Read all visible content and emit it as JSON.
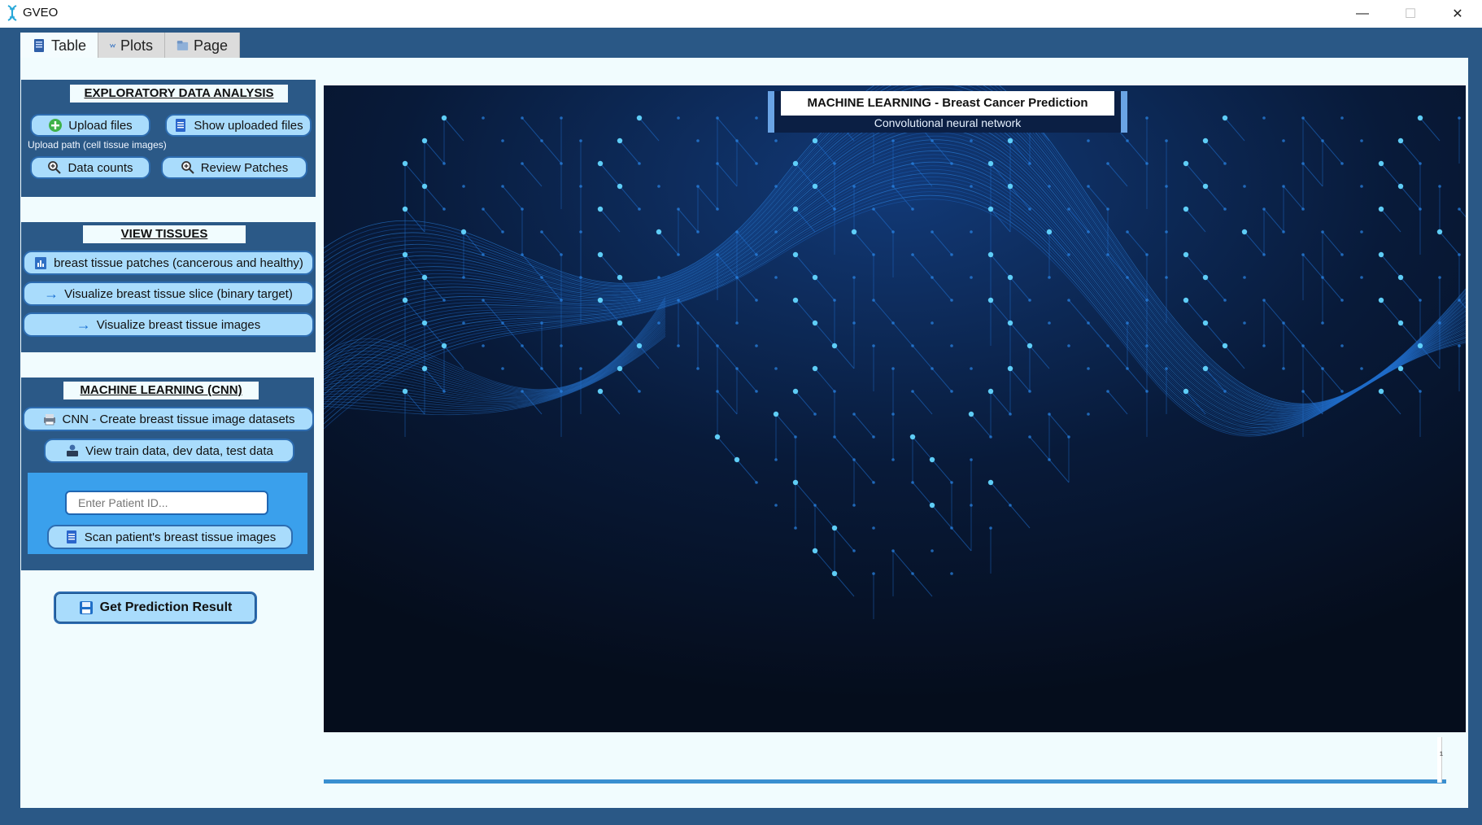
{
  "window": {
    "title": "GVEO",
    "minimize_glyph": "—",
    "maximize_glyph": "☐",
    "close_glyph": "✕"
  },
  "tabs": [
    {
      "label": "Table",
      "icon": "table-icon",
      "active": true
    },
    {
      "label": "Plots",
      "icon": "plots-icon",
      "active": false
    },
    {
      "label": "Page",
      "icon": "page-icon",
      "active": false
    }
  ],
  "eda": {
    "title": "EXPLORATORY DATA ANALYSIS",
    "upload_label": "Upload files",
    "show_uploaded_label": "Show uploaded files",
    "upload_path_label": "Upload path (cell tissue images)",
    "data_counts_label": "Data counts",
    "review_patches_label": "Review Patches"
  },
  "view_tissues": {
    "title": "VIEW TISSUES",
    "patches_label": "breast tissue patches (cancerous and healthy)",
    "slice_label": "Visualize  breast tissue slice (binary target)",
    "images_label": "Visualize  breast tissue images"
  },
  "ml": {
    "title": "MACHINE LEARNING (CNN)",
    "create_datasets_label": "CNN - Create breast tissue image datasets",
    "view_data_label": "View train data, dev data, test data",
    "patient_placeholder": "Enter Patient ID...",
    "scan_label": "Scan patient's breast tissue images"
  },
  "predict": {
    "label": "Get Prediction Result"
  },
  "hero": {
    "title": "MACHINE LEARNING  - Breast Cancer Prediction",
    "subtitle": "Convolutional neural network"
  },
  "bottom": {
    "caret": "¹"
  },
  "colors": {
    "frame": "#2a5886",
    "panel": "#f1fcfe",
    "button": "#a9dcfc",
    "button_border": "#2d6cb0",
    "hero_bg": "#06101f",
    "glow": "#2aa6ff"
  }
}
